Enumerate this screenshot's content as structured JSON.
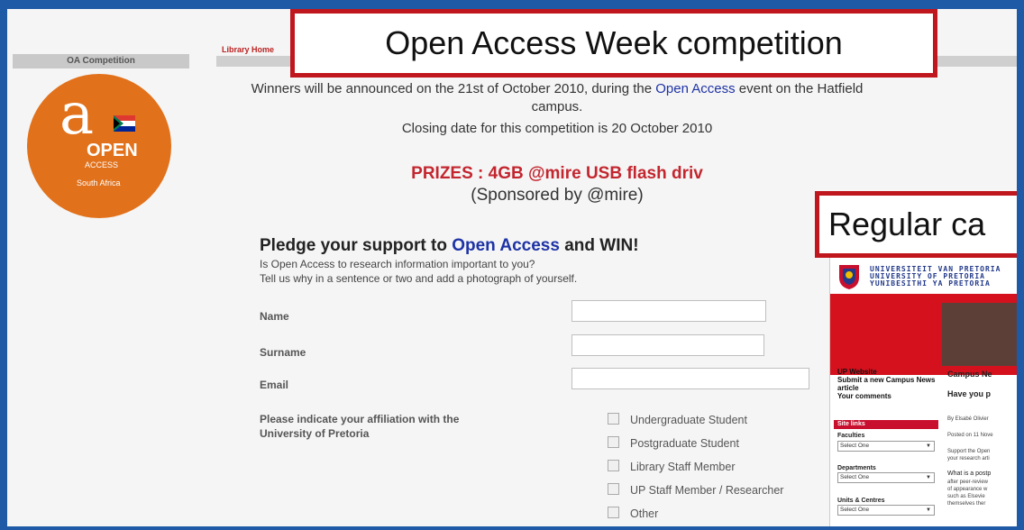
{
  "nav": {
    "library_home": "Library Home"
  },
  "sidebar": {
    "header": "OA Competition",
    "logo": {
      "open": "OPEN",
      "access": "ACCESS",
      "region": "South Africa"
    }
  },
  "announcement": {
    "line1_prefix": "Winners will be announced on the 21st of October 2010, during the ",
    "line1_link": "Open Access",
    "line1_suffix": " event on the Hatfield",
    "line2": "campus.",
    "closing": "Closing date for this competition is 20 October 2010"
  },
  "prizes": {
    "title": "PRIZES : 4GB @mire USB flash driv",
    "sponsor": "(Sponsored by @mire)"
  },
  "pledge": {
    "title_prefix": "Pledge your support to ",
    "title_link": "Open Access",
    "title_suffix": " and WIN!",
    "sub1": "Is Open Access to research information important to you?",
    "sub2": "Tell us why in a sentence or two and add a photograph of yourself."
  },
  "form": {
    "name_label": "Name",
    "surname_label": "Surname",
    "email_label": "Email",
    "affiliation_label_1": "Please indicate your affiliation with the",
    "affiliation_label_2": "University of Pretoria",
    "options": [
      "Undergraduate Student",
      "Postgraduate Student",
      "Library Staff Member",
      "UP Staff Member / Researcher",
      "Other"
    ]
  },
  "callouts": {
    "oa": "Open Access Week competition",
    "regular": "Regular ca"
  },
  "inset": {
    "uni_names": [
      "UNIVERSITEIT VAN PRETORIA",
      "UNIVERSITY OF PRETORIA",
      "YUNIBESITHI YA PRETORIA"
    ],
    "nav": [
      "UP Website",
      "Submit a new Campus News",
      "article",
      "Your comments"
    ],
    "site_links": "Site links",
    "faculties": "Faculties",
    "departments": "Departments",
    "units": "Units & Centres",
    "select_one": "Select One",
    "campus_news": "Campus Ne",
    "have_you": "Have you p",
    "by": "By Elsabé Olivier",
    "posted": "Posted on 11 Nove",
    "support1": "Support the Open",
    "support2": "your research arti",
    "what": "What is a postp",
    "l1": "after peer-review",
    "l2": "of appearance w",
    "l3": "such as Elsevie",
    "l4": "themselves ther"
  }
}
